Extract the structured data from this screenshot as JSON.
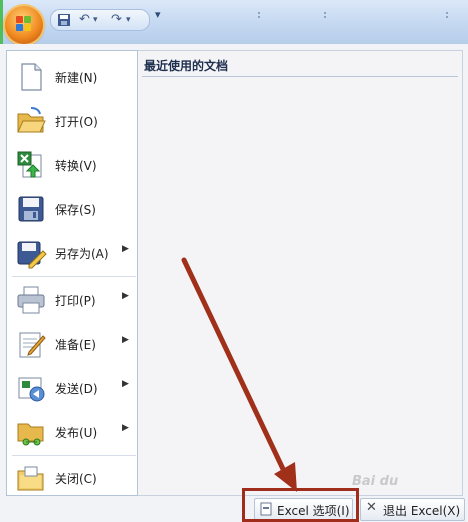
{
  "menu": {
    "items": [
      {
        "label": "新建(N)",
        "icon": "new-document-icon",
        "submenu": false
      },
      {
        "label": "打开(O)",
        "icon": "open-folder-icon",
        "submenu": false
      },
      {
        "label": "转换(V)",
        "icon": "convert-icon",
        "submenu": false
      },
      {
        "label": "保存(S)",
        "icon": "save-icon",
        "submenu": false
      },
      {
        "label": "另存为(A)",
        "icon": "save-as-icon",
        "submenu": true
      },
      {
        "label": "打印(P)",
        "icon": "printer-icon",
        "submenu": true
      },
      {
        "label": "准备(E)",
        "icon": "prepare-icon",
        "submenu": true
      },
      {
        "label": "发送(D)",
        "icon": "send-icon",
        "submenu": true
      },
      {
        "label": "发布(U)",
        "icon": "publish-icon",
        "submenu": true
      },
      {
        "label": "关闭(C)",
        "icon": "close-folder-icon",
        "submenu": false
      }
    ]
  },
  "recent": {
    "title": "最近使用的文档"
  },
  "footer": {
    "options_label": "Excel 选项(I)",
    "exit_label": "退出 Excel(X)"
  },
  "watermark": "Bai du",
  "colors": {
    "highlight": "#a02d1c",
    "arrow": "#a0301a"
  }
}
